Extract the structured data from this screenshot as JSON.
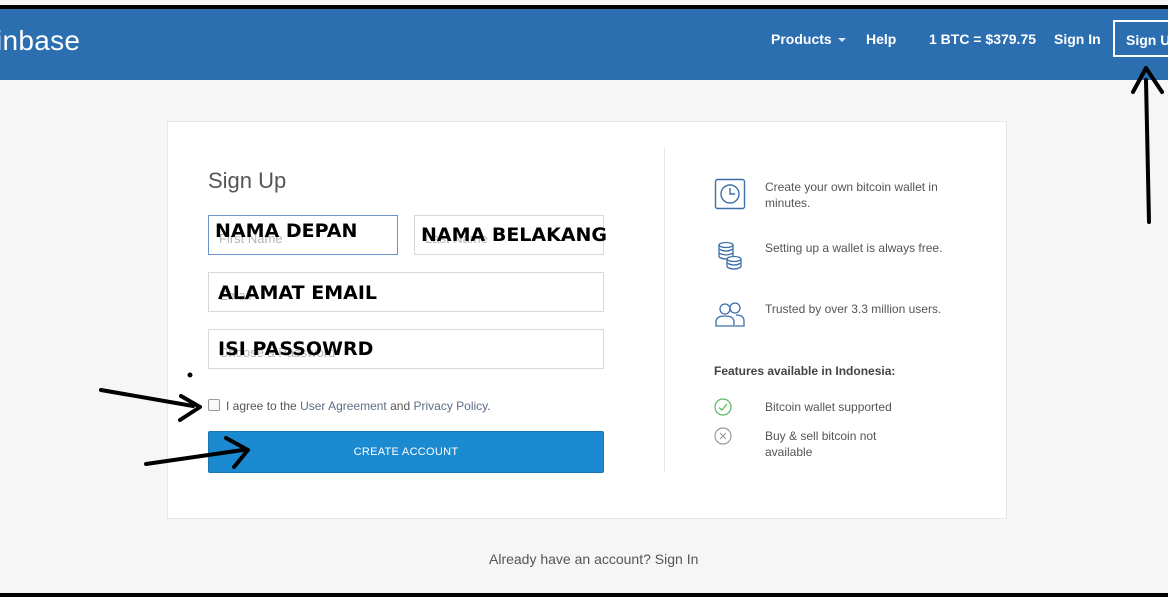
{
  "navbar": {
    "logo": "inbase",
    "products": "Products",
    "help": "Help",
    "price": "1 BTC = $379.75",
    "signin": "Sign In",
    "signup": "Sign Up"
  },
  "form": {
    "title": "Sign Up",
    "first_name": {
      "placeholder": "First Name",
      "overlay": "NAMA DEPAN"
    },
    "last_name": {
      "placeholder": "Last Name",
      "overlay": "NAMA BELAKANG"
    },
    "email": {
      "placeholder": "Email",
      "overlay": "ALAMAT EMAIL"
    },
    "password": {
      "placeholder": "Choose a Password",
      "overlay": "ISI PASSOWRD"
    },
    "agree_prefix": "I agree to the ",
    "user_agreement": "User Agreement",
    "and": " and ",
    "privacy_policy": "Privacy Policy",
    "period": ".",
    "create_button": "CREATE ACCOUNT"
  },
  "features": {
    "items": [
      {
        "icon": "clock-icon",
        "text": "Create your own bitcoin wallet in minutes."
      },
      {
        "icon": "coins-icon",
        "text": "Setting up a wallet is always free."
      },
      {
        "icon": "users-icon",
        "text": "Trusted by over 3.3 million users."
      }
    ],
    "heading": "Features available in Indonesia:",
    "availability": [
      {
        "icon": "check-circle-icon",
        "text": "Bitcoin wallet supported",
        "status_color": "#5cb85c"
      },
      {
        "icon": "x-circle-icon",
        "text": "Buy & sell bitcoin not available",
        "status_color": "#999999"
      }
    ]
  },
  "footer": {
    "prefix": "Already have an account? ",
    "signin": "Sign In"
  },
  "colors": {
    "navbar": "#2b6fb1",
    "button": "#1c8ad1",
    "icon": "#3d6fa8"
  }
}
